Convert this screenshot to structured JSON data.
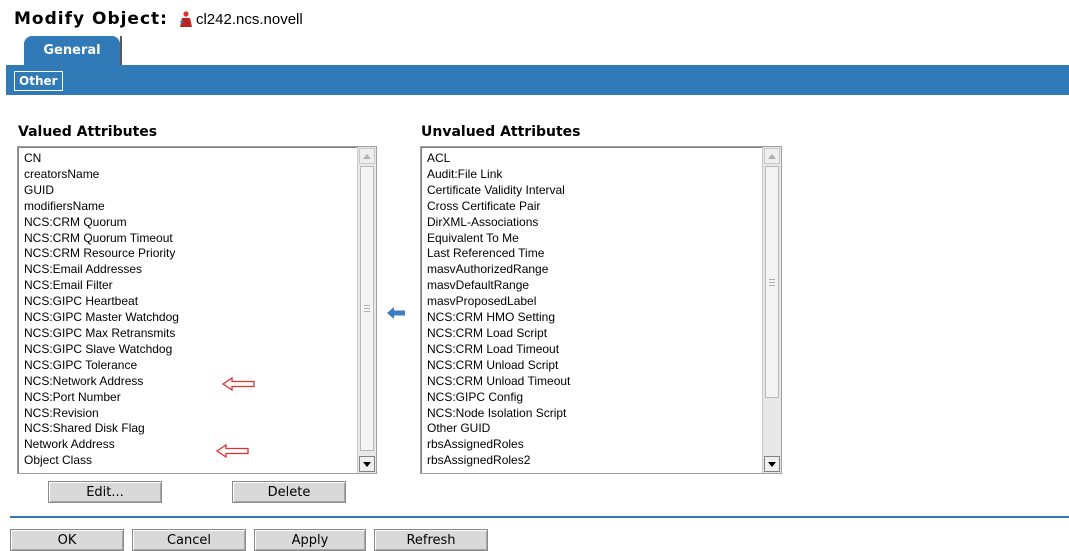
{
  "header": {
    "title": "Modify Object:",
    "object_name": "cl242.ncs.novell",
    "object_icon": "object-icon"
  },
  "tabs": {
    "general": "General",
    "other": "Other"
  },
  "valued": {
    "title": "Valued Attributes",
    "items": [
      "CN",
      "creatorsName",
      "GUID",
      "modifiersName",
      "NCS:CRM Quorum",
      "NCS:CRM Quorum Timeout",
      "NCS:CRM Resource Priority",
      "NCS:Email Addresses",
      "NCS:Email Filter",
      "NCS:GIPC Heartbeat",
      "NCS:GIPC Master Watchdog",
      "NCS:GIPC Max Retransmits",
      "NCS:GIPC Slave Watchdog",
      "NCS:GIPC Tolerance",
      "NCS:Network Address",
      "NCS:Port Number",
      "NCS:Revision",
      "NCS:Shared Disk Flag",
      "Network Address",
      "Object Class"
    ]
  },
  "unvalued": {
    "title": "Unvalued Attributes",
    "items": [
      "ACL",
      "Audit:File Link",
      "Certificate Validity Interval",
      "Cross Certificate Pair",
      "DirXML-Associations",
      "Equivalent To Me",
      "Last Referenced Time",
      "masvAuthorizedRange",
      "masvDefaultRange",
      "masvProposedLabel",
      "NCS:CRM HMO Setting",
      "NCS:CRM Load Script",
      "NCS:CRM Load Timeout",
      "NCS:CRM Unload Script",
      "NCS:CRM Unload Timeout",
      "NCS:GIPC Config",
      "NCS:Node Isolation Script",
      "Other GUID",
      "rbsAssignedRoles",
      "rbsAssignedRoles2"
    ]
  },
  "buttons": {
    "edit": "Edit...",
    "delete": "Delete",
    "ok": "OK",
    "cancel": "Cancel",
    "apply": "Apply",
    "refresh": "Refresh"
  },
  "colors": {
    "accent": "#2f7ab7",
    "annotation_arrow": "#e03030",
    "button_face": "#d9d9d9"
  }
}
